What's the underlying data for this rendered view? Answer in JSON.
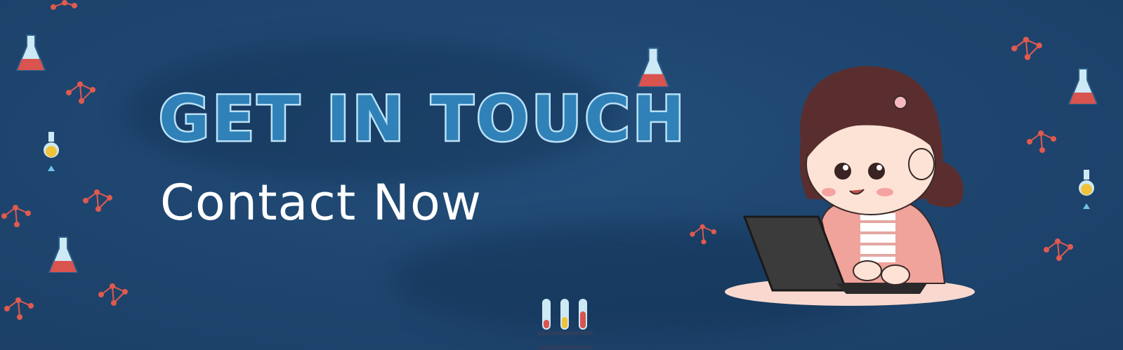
{
  "banner": {
    "title": "GET IN TOUCH",
    "subtitle": "Contact Now"
  },
  "colors": {
    "background": "#1f4670",
    "title_fill": "#2f81b8",
    "title_outline": "#c3e6f8",
    "flask_liquid": "#d9534f",
    "molecule": "#e05a4f"
  }
}
